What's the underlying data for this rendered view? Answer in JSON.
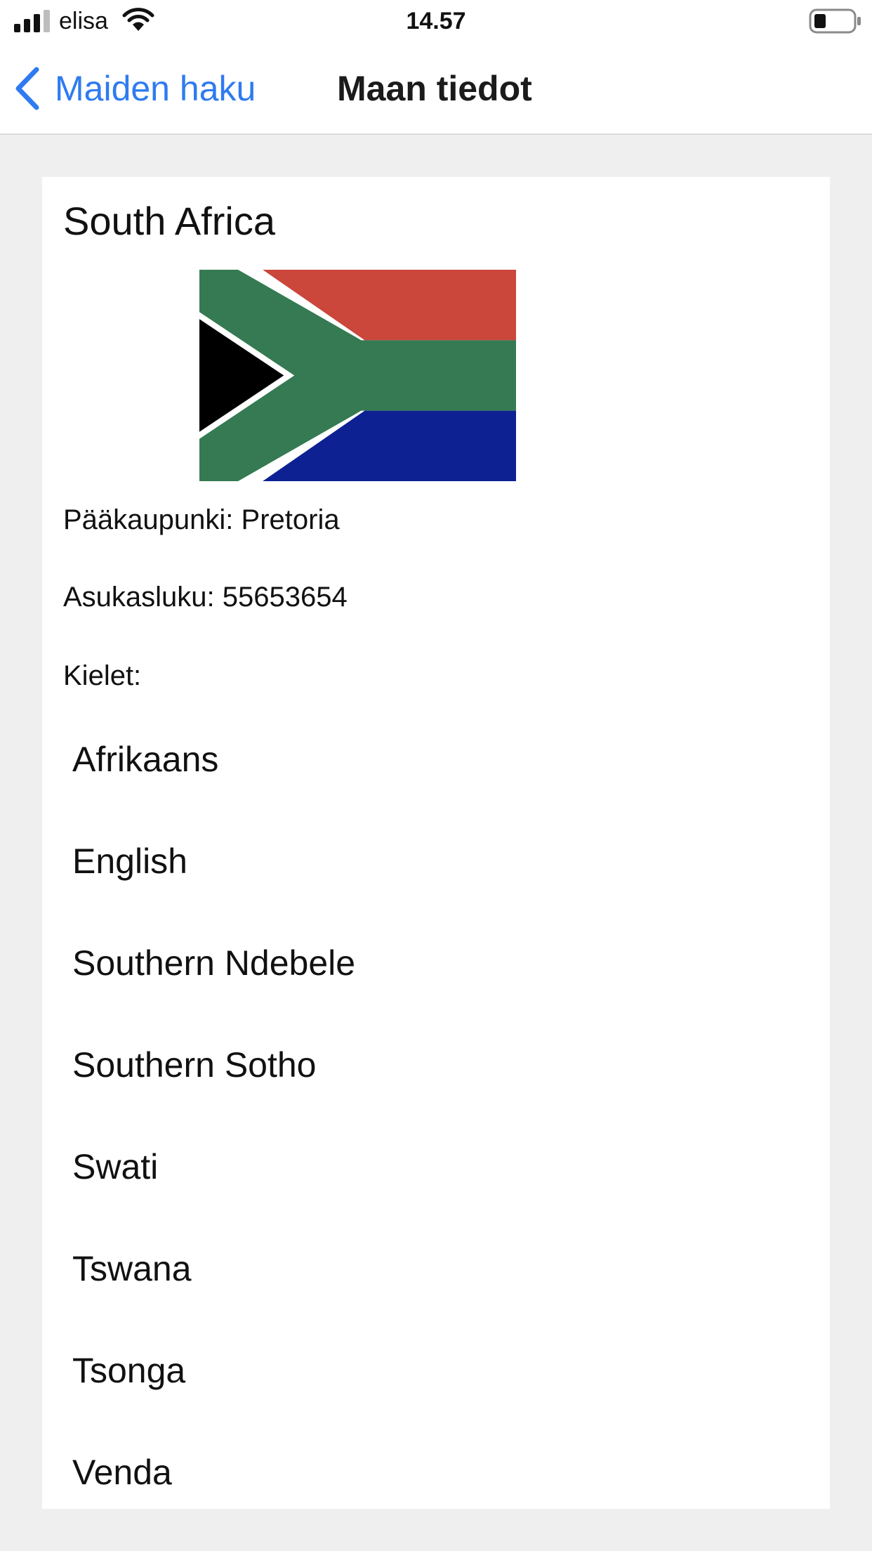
{
  "status_bar": {
    "carrier": "elisa",
    "time": "14.57",
    "icons": [
      "signal-icon",
      "wifi-icon",
      "battery-icon"
    ]
  },
  "nav": {
    "back_label": "Maiden haku",
    "title": "Maan tiedot",
    "back_icon": "chevron-left-icon",
    "accent_color": "#2f7bf0"
  },
  "country": {
    "name": "South Africa",
    "flag_icon": "south-africa-flag-icon",
    "capital_line": "Pääkaupunki: Pretoria",
    "population_line": "Asukasluku: 55653654",
    "languages_label": "Kielet:",
    "languages": [
      "Afrikaans",
      "English",
      "Southern Ndebele",
      "Southern Sotho",
      "Swati",
      "Tswana",
      "Tsonga",
      "Venda"
    ]
  }
}
